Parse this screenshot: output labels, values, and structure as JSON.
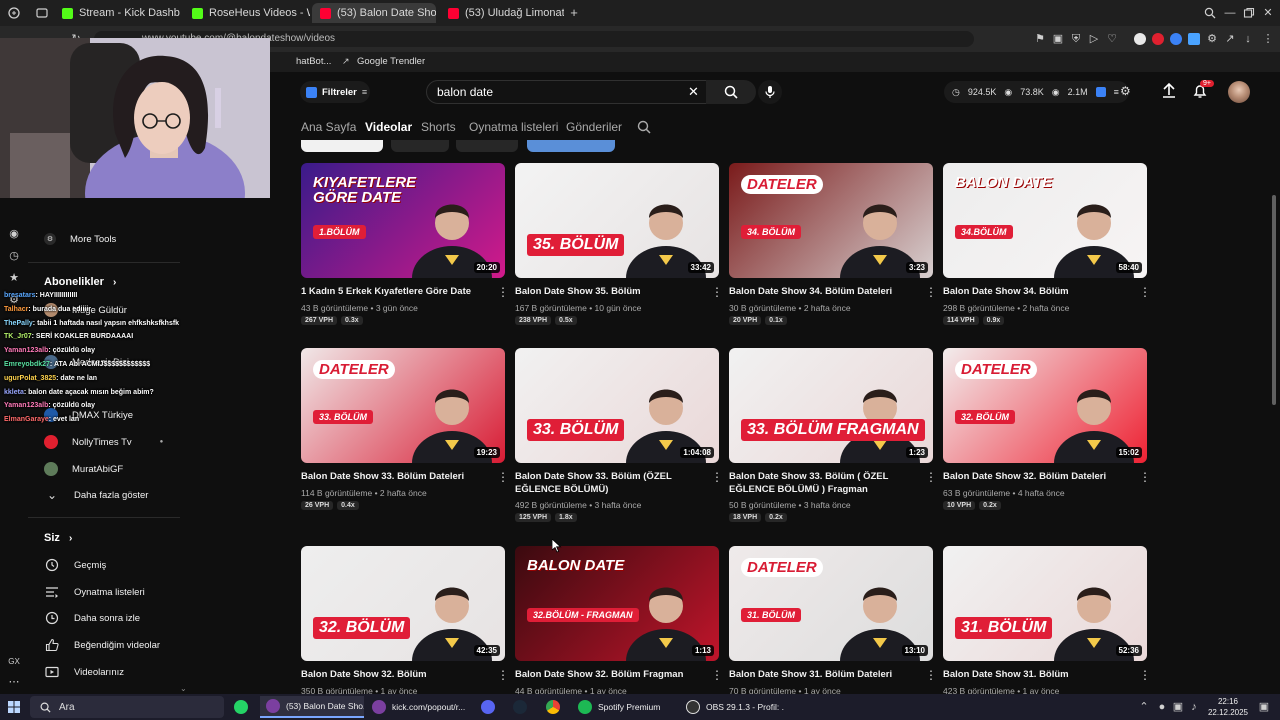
{
  "browser": {
    "tabs": [
      {
        "label": "Stream - Kick Dashboard",
        "icon": "kick-icon",
        "color": "#53fc18"
      },
      {
        "label": "RoseHeus Videos - Watc",
        "icon": "kick-icon",
        "color": "#53fc18"
      },
      {
        "label": "(53) Balon Date Show - Y",
        "icon": "youtube-icon",
        "color": "#ff0033",
        "active": true
      },
      {
        "label": "(53) Uludağ Limonata | Sa",
        "icon": "youtube-icon",
        "color": "#ff0033"
      }
    ],
    "address": "www.youtube.com/@balondateshow/videos",
    "bookmarks": [
      {
        "label": "hatBot..."
      },
      {
        "label": "Google Trendler"
      }
    ]
  },
  "header": {
    "filters_label": "Filtreler",
    "search_value": "balon date",
    "stats": {
      "views": "924.5K",
      "likes": "73.8K",
      "watch": "2.1M"
    },
    "notif_count": "9+"
  },
  "channel_nav": {
    "tabs": [
      "Ana Sayfa",
      "Videolar",
      "Shorts",
      "Oynatma listeleri",
      "Gönderiler"
    ],
    "active": "Videolar"
  },
  "videos": [
    {
      "title": "1 Kadın 5 Erkek Kıyafetlere Göre Date",
      "views": "43 B görüntüleme",
      "age": "3 gün önce",
      "vph": "267 VPH",
      "ratio": "0.3x",
      "duration": "20:20",
      "thumb_text": "KIYAFETLERE GÖRE DATE",
      "thumb_badge": "1.BÖLÜM"
    },
    {
      "title": "Balon Date Show 35. Bölüm",
      "views": "167 B görüntüleme",
      "age": "10 gün önce",
      "vph": "238 VPH",
      "ratio": "0.5x",
      "duration": "33:42",
      "thumb_text": "",
      "thumb_badge": "35. BÖLÜM"
    },
    {
      "title": "Balon Date Show 34. Bölüm Dateleri",
      "views": "30 B görüntüleme",
      "age": "2 hafta önce",
      "vph": "20 VPH",
      "ratio": "0.1x",
      "duration": "3:23",
      "thumb_text": "DATELER",
      "thumb_badge": "34. BÖLÜM"
    },
    {
      "title": "Balon Date Show 34. Bölüm",
      "views": "298 B görüntüleme",
      "age": "2 hafta önce",
      "vph": "114 VPH",
      "ratio": "0.9x",
      "duration": "58:40",
      "thumb_text": "BALON DATE",
      "thumb_badge": "34.BÖLÜM"
    },
    {
      "title": "Balon Date Show 33. Bölüm Dateleri",
      "views": "114 B görüntüleme",
      "age": "2 hafta önce",
      "vph": "26 VPH",
      "ratio": "0.4x",
      "duration": "19:23",
      "thumb_text": "DATELER",
      "thumb_badge": "33. BÖLÜM"
    },
    {
      "title": "Balon Date Show 33. Bölüm (ÖZEL EĞLENCE BÖLÜMÜ)",
      "views": "492 B görüntüleme",
      "age": "3 hafta önce",
      "vph": "125 VPH",
      "ratio": "1.8x",
      "duration": "1:04:08",
      "thumb_text": "",
      "thumb_badge": "33. BÖLÜM"
    },
    {
      "title": "Balon Date Show 33. Bölüm ( ÖZEL EĞLENCE BÖLÜMÜ ) Fragman",
      "views": "50 B görüntüleme",
      "age": "3 hafta önce",
      "vph": "18 VPH",
      "ratio": "0.2x",
      "duration": "1:23",
      "thumb_text": "",
      "thumb_badge": "33. BÖLÜM FRAGMAN"
    },
    {
      "title": "Balon Date Show 32. Bölüm Dateleri",
      "views": "63 B görüntüleme",
      "age": "4 hafta önce",
      "vph": "10 VPH",
      "ratio": "0.2x",
      "duration": "15:02",
      "thumb_text": "DATELER",
      "thumb_badge": "32. BÖLÜM"
    },
    {
      "title": "Balon Date Show 32. Bölüm",
      "views": "350 B görüntüleme",
      "age": "1 ay önce",
      "vph": "",
      "ratio": "",
      "duration": "42:35",
      "thumb_text": "",
      "thumb_badge": "32. BÖLÜM"
    },
    {
      "title": "Balon Date Show 32. Bölüm Fragman",
      "views": "44 B görüntüleme",
      "age": "1 ay önce",
      "vph": "",
      "ratio": "",
      "duration": "1:13",
      "thumb_text": "BALON DATE",
      "thumb_badge": "32.BÖLÜM - FRAGMAN"
    },
    {
      "title": "Balon Date Show 31. Bölüm Dateleri",
      "views": "70 B görüntüleme",
      "age": "1 ay önce",
      "vph": "",
      "ratio": "",
      "duration": "13:10",
      "thumb_text": "DATELER",
      "thumb_badge": "31. BÖLÜM"
    },
    {
      "title": "Balon Date Show 31. Bölüm",
      "views": "423 B görüntüleme",
      "age": "1 ay önce",
      "vph": "",
      "ratio": "",
      "duration": "52:36",
      "thumb_text": "",
      "thumb_badge": "31. BÖLÜM"
    }
  ],
  "sidebar": {
    "more_tools": "More Tools",
    "subs_heading": "Abonelikler",
    "subs": [
      {
        "label": "Müge Güldür"
      },
      {
        "label": "Medcezir Dizi"
      },
      {
        "label": "DMAX Türkiye"
      },
      {
        "label": "NollyTimes Tv"
      },
      {
        "label": "MuratAbiGF"
      }
    ],
    "show_more": "Daha fazla göster",
    "you_heading": "Siz",
    "you_items": [
      {
        "label": "Geçmiş",
        "icon": "history-icon"
      },
      {
        "label": "Oynatma listeleri",
        "icon": "playlist-icon"
      },
      {
        "label": "Daha sonra izle",
        "icon": "clock-icon"
      },
      {
        "label": "Beğendiğim videolar",
        "icon": "thumbs-up-icon"
      },
      {
        "label": "Videolarınız",
        "icon": "video-icon"
      }
    ]
  },
  "chat": [
    {
      "user": "bresatars",
      "msg": ": HAYIIIIIIIIIIII",
      "color": "#5aa8ff"
    },
    {
      "user": "Talhacr",
      "msg": ": burada dua ediiiir",
      "color": "#ff9b3d"
    },
    {
      "user": "ThePally",
      "msg": ": tabii 1 haftada nasıl yapsın ehfkshksfkhsfk",
      "color": "#8ad8ff"
    },
    {
      "user": "TK_Jr07",
      "msg": ": SERİ KOAKLER BURDAAAAI",
      "color": "#b5f36a"
    },
    {
      "user": "Yaman123alb",
      "msg": ": çözüldü olay",
      "color": "#ff7ab8"
    },
    {
      "user": "Emreyobdk27",
      "msg": ": ATA Abi ACMIJ$$$$$$$$$$$$",
      "color": "#58e0a0"
    },
    {
      "user": "ugurPolat_3825",
      "msg": ": date ne lan",
      "color": "#ffd34d"
    },
    {
      "user": "kkleta",
      "msg": ": balon date açacak mısın beğim abim?",
      "color": "#9aa7ff"
    },
    {
      "user": "Yaman123alb",
      "msg": ": çözüldü olay",
      "color": "#ff7ab8"
    },
    {
      "user": "ElmanGaraye",
      "msg": ": evet lan",
      "color": "#ff6a6a"
    }
  ],
  "taskbar": {
    "search": "Ara",
    "items": [
      {
        "label": "(53) Balon Date Sho...",
        "icon": "browser-icon",
        "color": "#7b3fa0",
        "active": true
      },
      {
        "label": "kick.com/popout/r...",
        "icon": "browser-icon",
        "color": "#7b3fa0"
      },
      {
        "label": "Spotify Premium",
        "icon": "spotify-icon",
        "color": "#1db954"
      },
      {
        "label": "OBS 29.1.3 - Profil: ...",
        "icon": "obs-icon",
        "color": "#333"
      }
    ],
    "time": "22:16",
    "date": "22.12.2025"
  }
}
